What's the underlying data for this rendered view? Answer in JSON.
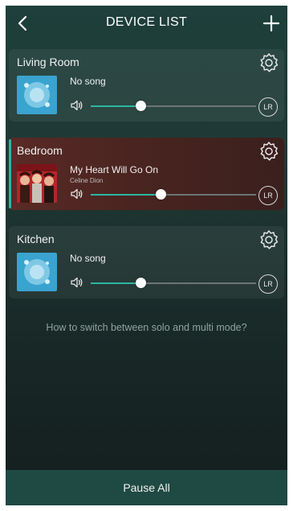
{
  "header": {
    "title": "DEVICE LIST"
  },
  "devices": [
    {
      "room": "Living Room",
      "song": "No song",
      "artist": "",
      "volume": 0.3,
      "channel": "LR",
      "active": false
    },
    {
      "room": "Bedroom",
      "song": "My Heart Will Go On",
      "artist": "Celine Dion",
      "volume": 0.42,
      "channel": "LR",
      "active": true
    },
    {
      "room": "Kitchen",
      "song": "No song",
      "artist": "",
      "volume": 0.3,
      "channel": "LR",
      "active": false
    }
  ],
  "help_link": "How to switch between solo and multi mode?",
  "footer": {
    "pause_all": "Pause All"
  },
  "colors": {
    "accent": "#2bb7a0",
    "footer_bg": "#1f4a44",
    "active_card": "#4a2420"
  },
  "icons": {
    "back": "chevron-left-icon",
    "add": "plus-icon",
    "settings": "gear-icon",
    "volume": "speaker-icon"
  }
}
